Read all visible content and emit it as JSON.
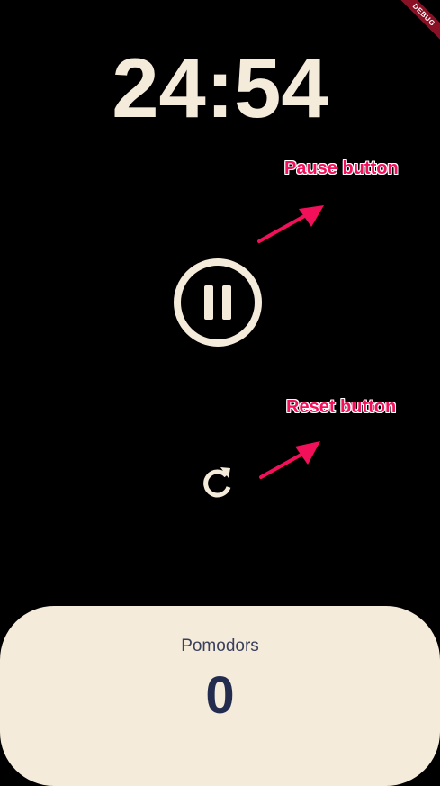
{
  "debug_banner": "DEBUG",
  "timer": {
    "display": "24:54"
  },
  "annotations": {
    "pause": "Pause button",
    "reset": "Reset button"
  },
  "controls": {
    "pause_icon": "pause-circle-outline-icon",
    "reset_icon": "refresh-icon"
  },
  "pomodoros": {
    "label": "Pomodors",
    "count": "0"
  },
  "colors": {
    "background": "#000000",
    "foreground": "#f4ebdb",
    "panel": "#f4ebdb",
    "count_text": "#232b4f",
    "annotation": "#f2105a",
    "debug": "#8a1026"
  }
}
